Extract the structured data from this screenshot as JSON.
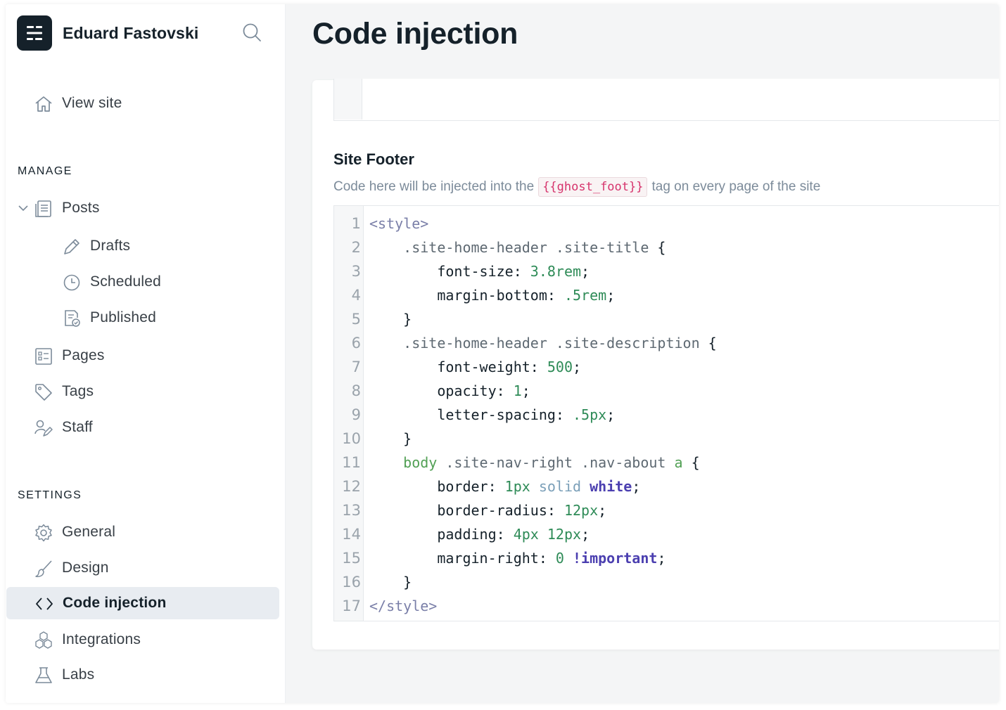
{
  "sidebar": {
    "site_name": "Eduard Fastovski",
    "view_site": "View site",
    "manage_title": "MANAGE",
    "settings_title": "SETTINGS",
    "manage_items": [
      {
        "label": "Posts",
        "icon": "posts-icon"
      },
      {
        "label": "Drafts",
        "icon": "pencil-icon"
      },
      {
        "label": "Scheduled",
        "icon": "clock-icon"
      },
      {
        "label": "Published",
        "icon": "published-icon"
      },
      {
        "label": "Pages",
        "icon": "pages-icon"
      },
      {
        "label": "Tags",
        "icon": "tag-icon"
      },
      {
        "label": "Staff",
        "icon": "staff-icon"
      }
    ],
    "settings_items": [
      {
        "label": "General",
        "icon": "gear-icon"
      },
      {
        "label": "Design",
        "icon": "brush-icon"
      },
      {
        "label": "Code injection",
        "icon": "code-icon",
        "active": true
      },
      {
        "label": "Integrations",
        "icon": "integrations-icon"
      },
      {
        "label": "Labs",
        "icon": "flask-icon"
      }
    ]
  },
  "main": {
    "title": "Code injection",
    "footer_section": {
      "title": "Site Footer",
      "desc_before": "Code here will be injected into the",
      "desc_tag": "{{ghost_foot}}",
      "desc_after": "tag on every page of the site"
    },
    "code_lines": [
      {
        "n": "1",
        "text": "<style>"
      },
      {
        "n": "2",
        "text": "    .site-home-header .site-title {"
      },
      {
        "n": "3",
        "text": "        font-size: 3.8rem;"
      },
      {
        "n": "4",
        "text": "        margin-bottom: .5rem;"
      },
      {
        "n": "5",
        "text": "    }"
      },
      {
        "n": "6",
        "text": "    .site-home-header .site-description {"
      },
      {
        "n": "7",
        "text": "        font-weight: 500;"
      },
      {
        "n": "8",
        "text": "        opacity: 1;"
      },
      {
        "n": "9",
        "text": "        letter-spacing: .5px;"
      },
      {
        "n": "10",
        "text": "    }"
      },
      {
        "n": "11",
        "text": "    body .site-nav-right .nav-about a {"
      },
      {
        "n": "12",
        "text": "        border: 1px solid white;"
      },
      {
        "n": "13",
        "text": "        border-radius: 12px;"
      },
      {
        "n": "14",
        "text": "        padding: 4px 12px;"
      },
      {
        "n": "15",
        "text": "        margin-right: 0 !important;"
      },
      {
        "n": "16",
        "text": "    }"
      },
      {
        "n": "17",
        "text": "</style>"
      }
    ]
  },
  "colors": {
    "sidebar_active_bg": "#e8ecf1",
    "main_bg": "#f4f5f6",
    "tag_color": "#d6336c",
    "number_color": "#2e8b57",
    "keyword_bold": "#4b3fb0"
  }
}
